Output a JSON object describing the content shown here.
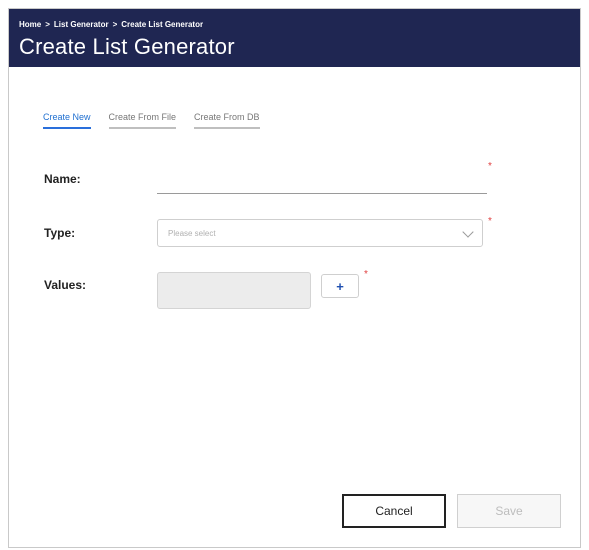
{
  "header": {
    "breadcrumb": [
      "Home",
      "List Generator",
      "Create List Generator"
    ],
    "separator": ">",
    "title": "Create List Generator"
  },
  "tabs": [
    {
      "label": "Create New",
      "active": true
    },
    {
      "label": "Create From File",
      "active": false
    },
    {
      "label": "Create From DB",
      "active": false
    }
  ],
  "form": {
    "name_label": "Name:",
    "type_label": "Type:",
    "type_placeholder": "Please select",
    "values_label": "Values:",
    "add_value_label": "+",
    "required_mark": "*"
  },
  "footer": {
    "cancel_label": "Cancel",
    "save_label": "Save"
  },
  "colors": {
    "header_bg": "#1f2652",
    "active_tab": "#2a6fdb",
    "required": "#e04040"
  }
}
